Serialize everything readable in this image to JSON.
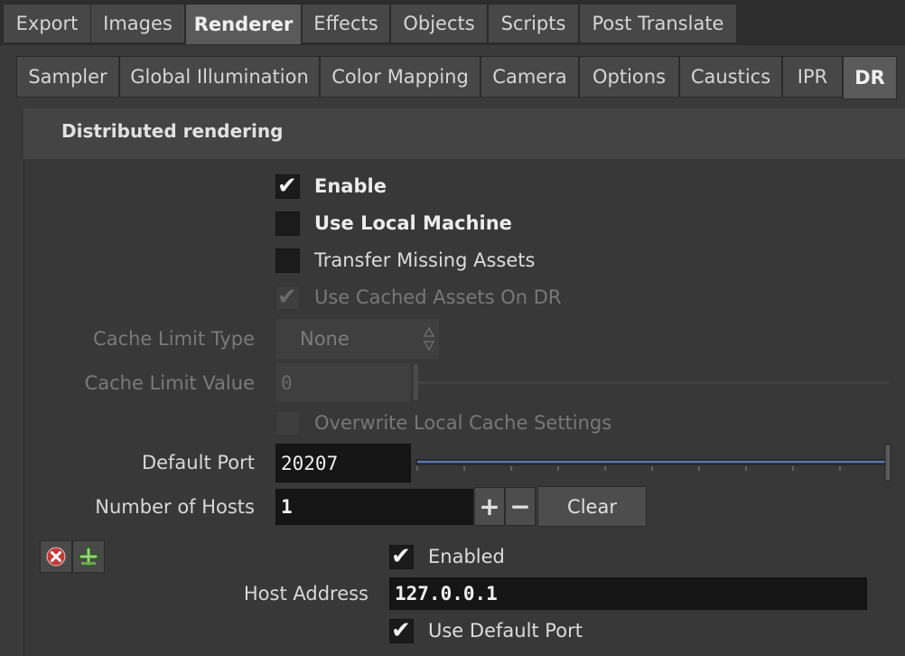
{
  "top_tabs": [
    "Export",
    "Images",
    "Renderer",
    "Effects",
    "Objects",
    "Scripts",
    "Post Translate"
  ],
  "sub_tabs": [
    "Sampler",
    "Global Illumination",
    "Color Mapping",
    "Camera",
    "Options",
    "Caustics",
    "IPR",
    "DR"
  ],
  "section": {
    "title": "Distributed rendering"
  },
  "options": {
    "enable": {
      "label": "Enable",
      "checked": true
    },
    "use_local_machine": {
      "label": "Use Local Machine",
      "checked": false
    },
    "transfer_missing_assets": {
      "label": "Transfer Missing Assets",
      "checked": false
    },
    "use_cached_assets": {
      "label": "Use Cached Assets On DR",
      "checked": true,
      "disabled": true
    },
    "overwrite_local_cache": {
      "label": "Overwrite Local Cache Settings",
      "checked": false,
      "disabled": true
    }
  },
  "cache_limit_type": {
    "label": "Cache Limit Type",
    "value": "None"
  },
  "cache_limit_value": {
    "label": "Cache Limit Value",
    "value": "0"
  },
  "default_port": {
    "label": "Default Port",
    "value": "20207"
  },
  "number_of_hosts": {
    "label": "Number of Hosts",
    "value": "1",
    "plus": "+",
    "minus": "−",
    "clear": "Clear"
  },
  "host": {
    "enabled": {
      "label": "Enabled",
      "checked": true
    },
    "address_label": "Host Address",
    "address_value": "127.0.0.1",
    "use_default_port": {
      "label": "Use Default Port",
      "checked": true
    }
  },
  "icons": {
    "remove": "remove-icon",
    "add": "add-icon",
    "check": "✔"
  },
  "colors": {
    "slider_fill": "#4a6a9a",
    "remove_red": "#d03a3a",
    "add_green": "#8fcf6f"
  }
}
